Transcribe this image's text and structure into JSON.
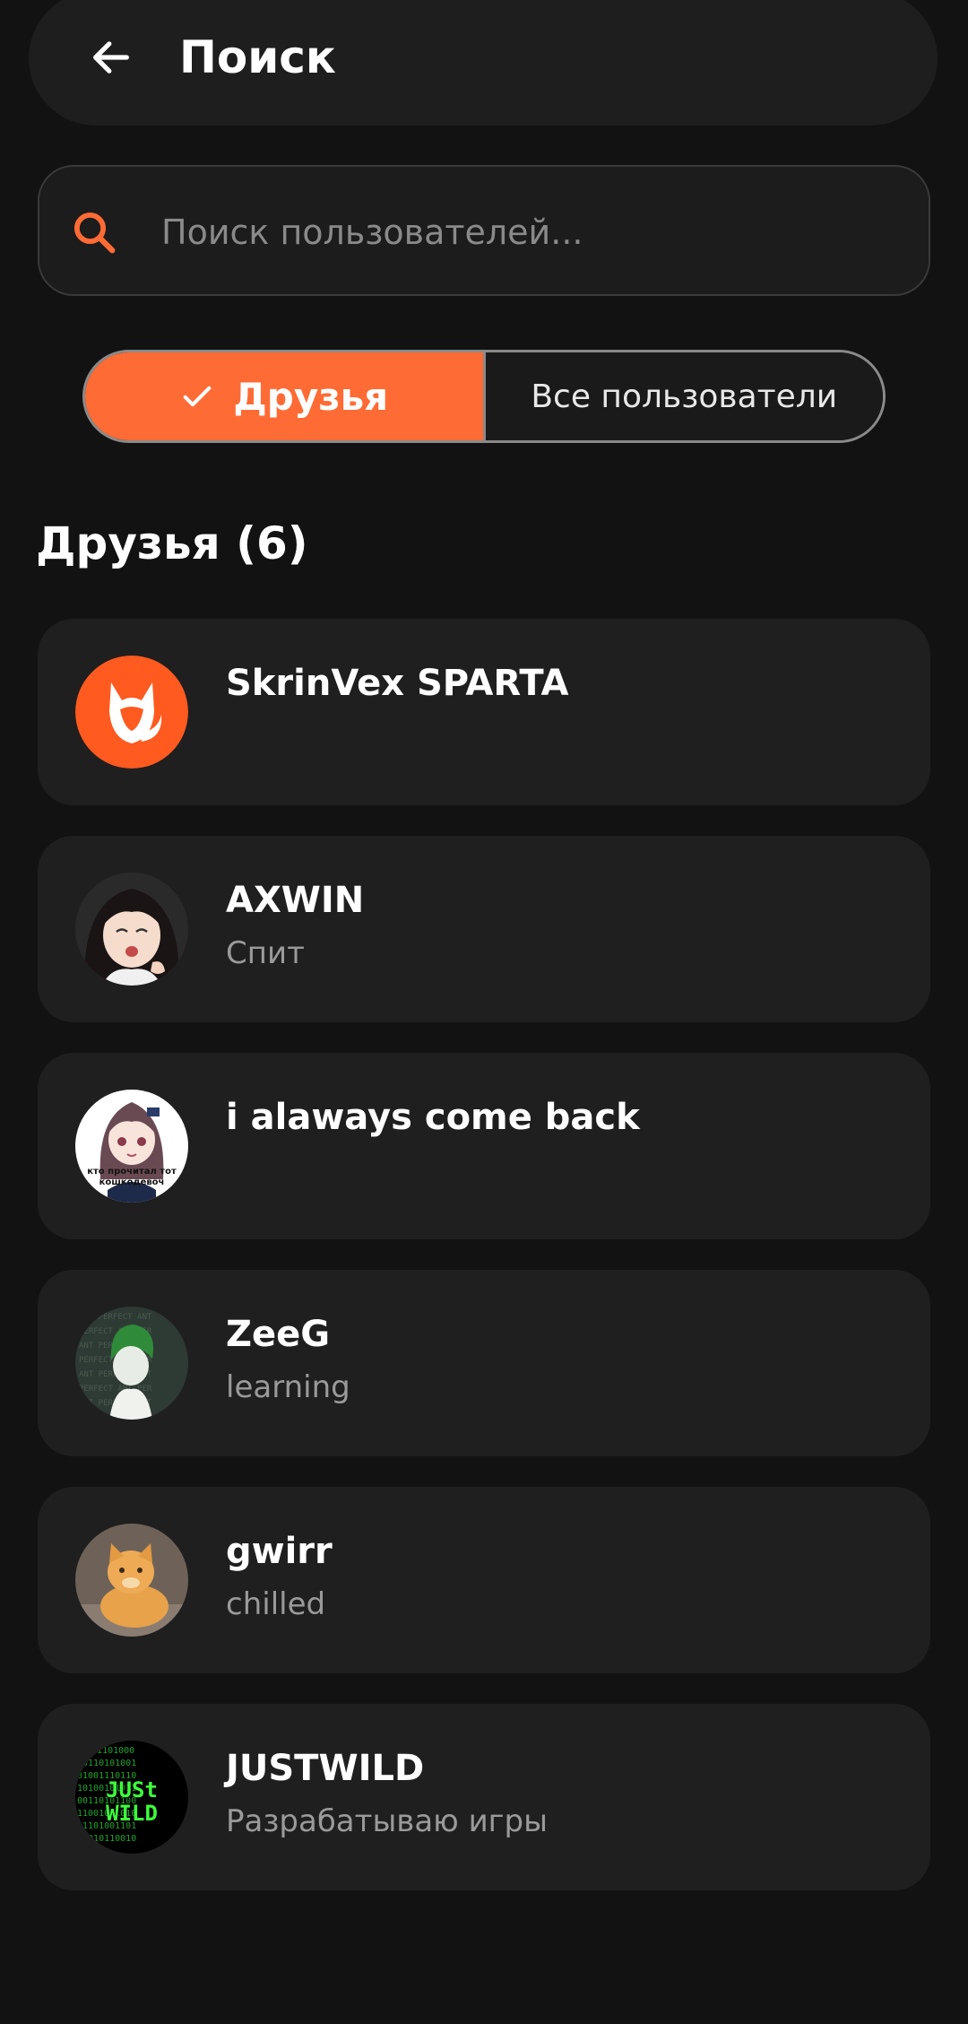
{
  "header": {
    "title": "Поиск",
    "back_icon": "arrow-left-icon"
  },
  "search": {
    "placeholder": "Поиск пользователей...",
    "value": "",
    "icon": "search-icon",
    "icon_color": "#ff6b35"
  },
  "tabs": [
    {
      "label": "Друзья",
      "selected": true,
      "icon": "check-icon"
    },
    {
      "label": "Все пользователи",
      "selected": false
    }
  ],
  "friends": {
    "title": "Друзья (6)",
    "items": [
      {
        "name": "SkrinVex SPARTA",
        "status": "",
        "avatar": "fox-logo-avatar"
      },
      {
        "name": "AXWIN",
        "status": "Спит",
        "avatar": "anime-girl-avatar"
      },
      {
        "name": "i alaways come back",
        "status": "",
        "avatar": "anime-meme-avatar",
        "avatar_caption": "кто прочитал тот кошкодевоч"
      },
      {
        "name": "ZeeG",
        "status": "learning",
        "avatar": "green-hair-avatar"
      },
      {
        "name": "gwirr",
        "status": "chilled",
        "avatar": "cat-avatar"
      },
      {
        "name": "JUSTWILD",
        "status": "Разрабатываю игры",
        "avatar": "matrix-justwild-avatar",
        "avatar_caption": "JUSt WILD"
      }
    ]
  },
  "colors": {
    "accent": "#ff6b35",
    "background": "#121212",
    "card": "#1f1f1f"
  }
}
